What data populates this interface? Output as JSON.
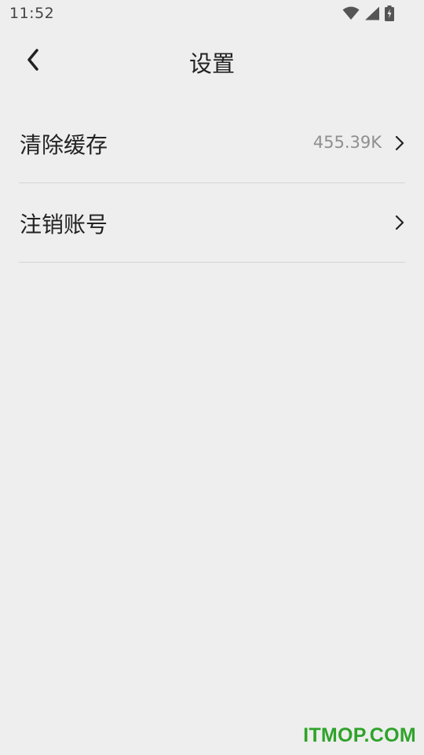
{
  "status_bar": {
    "time": "11:52",
    "icons": [
      "wifi-icon",
      "signal-icon",
      "battery-charging-icon"
    ]
  },
  "header": {
    "title": "设置",
    "back_icon": "chevron-left-icon"
  },
  "settings": {
    "items": [
      {
        "label": "清除缓存",
        "value": "455.39K",
        "icon": "chevron-right-icon"
      },
      {
        "label": "注销账号",
        "value": "",
        "icon": "chevron-right-icon"
      }
    ]
  },
  "watermark": {
    "text": "ITMOP.COM",
    "color": "#2fa32a"
  },
  "colors": {
    "background": "#eeeeee",
    "divider": "#d4d4d4",
    "value_text": "#8f8f8f"
  }
}
